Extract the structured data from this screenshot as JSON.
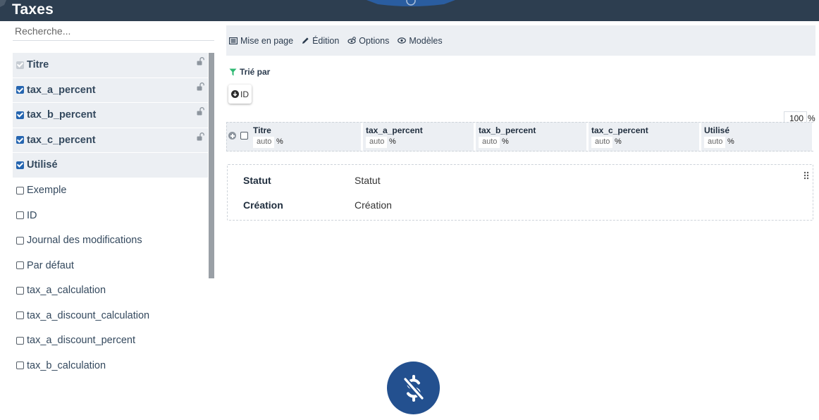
{
  "app": {
    "title": "Taxes"
  },
  "search": {
    "placeholder": "Recherche..."
  },
  "fields": [
    {
      "label": "Titre",
      "state": "disabled-checked",
      "locked": true
    },
    {
      "label": "tax_a_percent",
      "state": "checked",
      "locked": true
    },
    {
      "label": "tax_b_percent",
      "state": "checked",
      "locked": true
    },
    {
      "label": "tax_c_percent",
      "state": "checked",
      "locked": true
    },
    {
      "label": "Utilisé",
      "state": "checked",
      "locked": false
    },
    {
      "label": "Exemple",
      "state": "unchecked"
    },
    {
      "label": "ID",
      "state": "unchecked"
    },
    {
      "label": "Journal des modifications",
      "state": "unchecked"
    },
    {
      "label": "Par défaut",
      "state": "unchecked"
    },
    {
      "label": "tax_a_calculation",
      "state": "unchecked"
    },
    {
      "label": "tax_a_discount_calculation",
      "state": "unchecked"
    },
    {
      "label": "tax_a_discount_percent",
      "state": "unchecked"
    },
    {
      "label": "tax_b_calculation",
      "state": "unchecked"
    }
  ],
  "toolbar": {
    "layout_label": "Mise en page",
    "edit_label": "Édition",
    "options_label": "Options",
    "templates_label": "Modèles"
  },
  "sort": {
    "label": "Trié par",
    "field": "ID"
  },
  "table_width": {
    "value": "100",
    "unit": "%"
  },
  "columns": [
    {
      "name": "Titre",
      "width": "auto",
      "unit": "%"
    },
    {
      "name": "tax_a_percent",
      "width": "auto",
      "unit": "%"
    },
    {
      "name": "tax_b_percent",
      "width": "auto",
      "unit": "%"
    },
    {
      "name": "tax_c_percent",
      "width": "auto",
      "unit": "%"
    },
    {
      "name": "Utilisé",
      "width": "auto",
      "unit": "%"
    }
  ],
  "detail_rows": [
    {
      "key": "Statut",
      "value": "Statut"
    },
    {
      "key": "Création",
      "value": "Création"
    }
  ],
  "colors": {
    "header_bg": "#2d3e50",
    "accent_blue": "#2565b0",
    "filter_green": "#2eb872",
    "logo_bg": "#23508f"
  },
  "icons": {
    "toolbar": [
      "layout-icon",
      "pencil-icon",
      "options-icon",
      "eye-icon"
    ],
    "sort": "filter-icon",
    "sort_direction": "arrow-down-circle-icon",
    "logo": "no-dollar-icon"
  }
}
